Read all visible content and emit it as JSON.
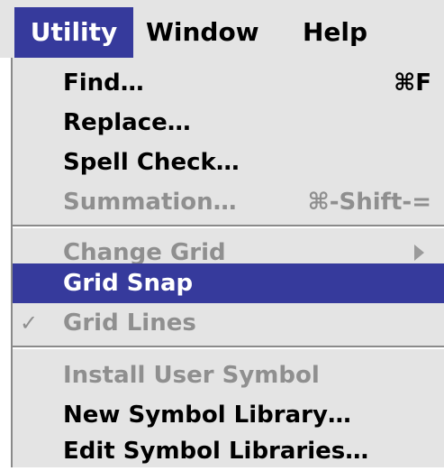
{
  "menubar": {
    "items": [
      {
        "label": "Utility",
        "selected": true
      },
      {
        "label": "Window",
        "selected": false
      },
      {
        "label": "Help",
        "selected": false
      }
    ]
  },
  "utility_menu": {
    "find": {
      "label": "Find…",
      "shortcut": "⌘F",
      "enabled": true
    },
    "replace": {
      "label": "Replace…",
      "enabled": true
    },
    "spell_check": {
      "label": "Spell Check…",
      "enabled": true
    },
    "summation": {
      "label": "Summation…",
      "shortcut": "⌘-Shift-=",
      "enabled": false
    },
    "change_grid": {
      "label": "Change Grid",
      "enabled": false,
      "submenu": true
    },
    "grid_snap": {
      "label": "Grid Snap",
      "enabled": true,
      "highlighted": true
    },
    "grid_lines": {
      "label": "Grid Lines",
      "enabled": false,
      "checked": true,
      "check_glyph": "✓"
    },
    "install_user_symbol": {
      "label": "Install User Symbol",
      "enabled": false
    },
    "new_symbol_library": {
      "label": "New Symbol Library…",
      "enabled": true
    },
    "edit_symbol_libraries": {
      "label": "Edit Symbol Libraries…",
      "enabled": true
    }
  },
  "colors": {
    "menu_background": "#e4e4e4",
    "selection": "#363a9c",
    "disabled_text": "#8f8f8f"
  }
}
